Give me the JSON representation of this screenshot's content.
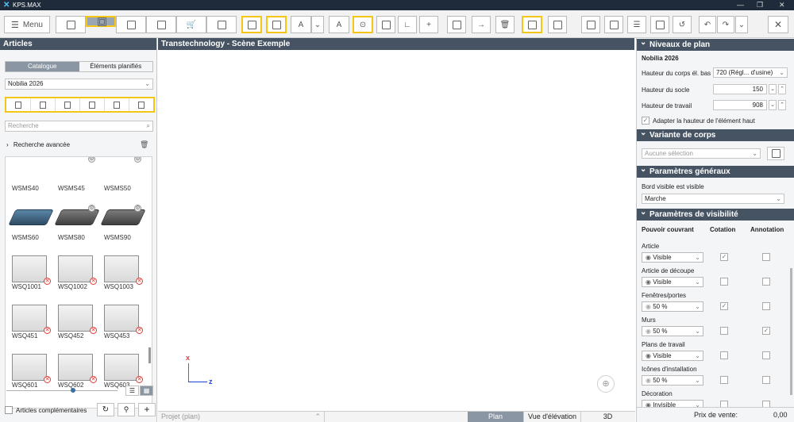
{
  "app": {
    "title": "KPS.MAX"
  },
  "toolbar": {
    "menu_label": "Menu"
  },
  "left": {
    "title": "Articles",
    "tabs": [
      "Catalogue",
      "Éléments planifiés"
    ],
    "catalog_select": "Nobilia 2026",
    "search_placeholder": "Recherche",
    "advanced_search": "Recherche avancée",
    "items": [
      {
        "label": "WSMS40",
        "kind": "sink-cut",
        "badge": ""
      },
      {
        "label": "WSMS45",
        "kind": "sink-cut",
        "badge": "c"
      },
      {
        "label": "WSMS50",
        "kind": "sink-cut",
        "badge": "c"
      },
      {
        "label": "WSMS60",
        "kind": "sink",
        "badge": ""
      },
      {
        "label": "WSMS80",
        "kind": "sink-dark",
        "badge": "c"
      },
      {
        "label": "WSMS90",
        "kind": "sink-dark",
        "badge": "c"
      },
      {
        "label": "WSQ1001",
        "kind": "cab",
        "badge": "x"
      },
      {
        "label": "WSQ1002",
        "kind": "cab",
        "badge": "x"
      },
      {
        "label": "WSQ1003",
        "kind": "cab",
        "badge": "x"
      },
      {
        "label": "WSQ451",
        "kind": "cab",
        "badge": "x"
      },
      {
        "label": "WSQ452",
        "kind": "cab",
        "badge": "x"
      },
      {
        "label": "WSQ453",
        "kind": "cab",
        "badge": "x"
      },
      {
        "label": "WSQ601",
        "kind": "cab",
        "badge": "x"
      },
      {
        "label": "WSQ602",
        "kind": "cab",
        "badge": "x"
      },
      {
        "label": "WSQ603",
        "kind": "cab",
        "badge": "x"
      }
    ],
    "zoom_level": 0.6,
    "complementary": "Articles complémentaires"
  },
  "center": {
    "title": "Transtechnology - Scène Exemple",
    "axis_x": "x",
    "axis_z": "z",
    "project_select": "Projet (plan)",
    "views": [
      "Plan",
      "Vue d'élévation",
      "3D"
    ]
  },
  "right": {
    "sections": {
      "niveaux": "Niveaux de plan",
      "variante": "Variante de corps",
      "generaux": "Paramètres généraux",
      "visibilite": "Paramètres de visibilité"
    },
    "catalog": "Nobilia 2026",
    "fields": [
      {
        "label": "Hauteur du corps él. bas",
        "value": "720 (Régl... d'usine)"
      },
      {
        "label": "Hauteur du socle",
        "value": "150"
      },
      {
        "label": "Hauteur de travail",
        "value": "908"
      }
    ],
    "adapt_label": "Adapter la hauteur de l'élément haut",
    "variant_placeholder": "Aucune sélection",
    "border_label": "Bord visible est visible",
    "border_value": "Marche",
    "cols": [
      "Pouvoir couvrant",
      "Cotation",
      "Annotation"
    ],
    "vis_rows": [
      {
        "name": "Article",
        "value": "Visible",
        "cot": true,
        "ann": false,
        "dim": false
      },
      {
        "name": "Article de découpe",
        "value": "Visible",
        "cot": false,
        "ann": false,
        "dim": false
      },
      {
        "name": "Fenêtres/portes",
        "value": "50 %",
        "cot": true,
        "ann": false,
        "dim": true
      },
      {
        "name": "Murs",
        "value": "50 %",
        "cot": false,
        "ann": true,
        "dim": true
      },
      {
        "name": "Plans de travail",
        "value": "Visible",
        "cot": false,
        "ann": false,
        "dim": false
      },
      {
        "name": "Icônes d'installation",
        "value": "50 %",
        "cot": false,
        "ann": false,
        "dim": true
      },
      {
        "name": "Décoration",
        "value": "Invisible",
        "cot": false,
        "ann": false,
        "dim": false
      }
    ],
    "price_label": "Prix de vente:",
    "price_value": "0,00"
  },
  "colors": {
    "header": "#465363",
    "highlight": "#f5c518",
    "titlebar": "#1f2b3a"
  }
}
